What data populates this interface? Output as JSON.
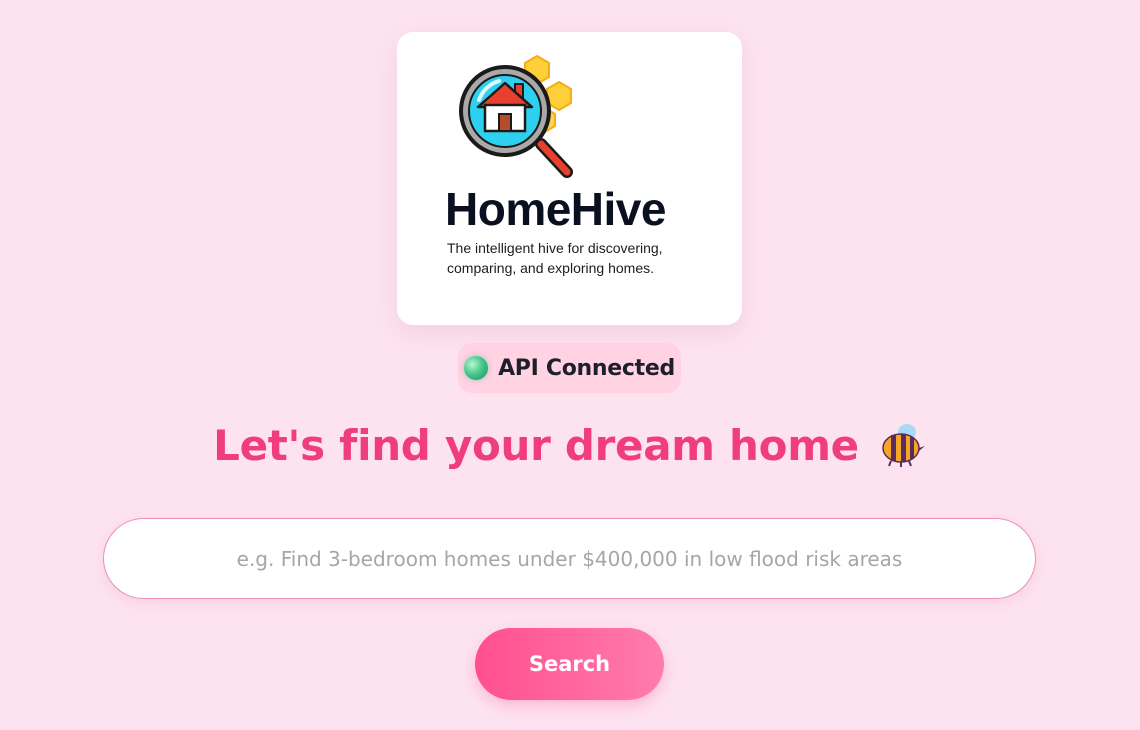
{
  "brand": {
    "name": "HomeHive",
    "tagline": "The intelligent hive for discovering, comparing, and exploring homes.",
    "logo_icon": "magnifier-house-honeycomb-icon"
  },
  "status": {
    "label": "API Connected",
    "icon": "status-dot-icon",
    "color": "#45c98b"
  },
  "hero": {
    "headline": "Let's find your dream home",
    "emoji_icon": "bee-icon"
  },
  "search": {
    "placeholder": "e.g. Find 3-bedroom homes under $400,000 in low flood risk areas",
    "value": "",
    "button_label": "Search"
  },
  "colors": {
    "background": "#fde3ef",
    "accent": "#f03d7b",
    "button_gradient_start": "#ff4f8c",
    "button_gradient_end": "#ff7cae"
  }
}
